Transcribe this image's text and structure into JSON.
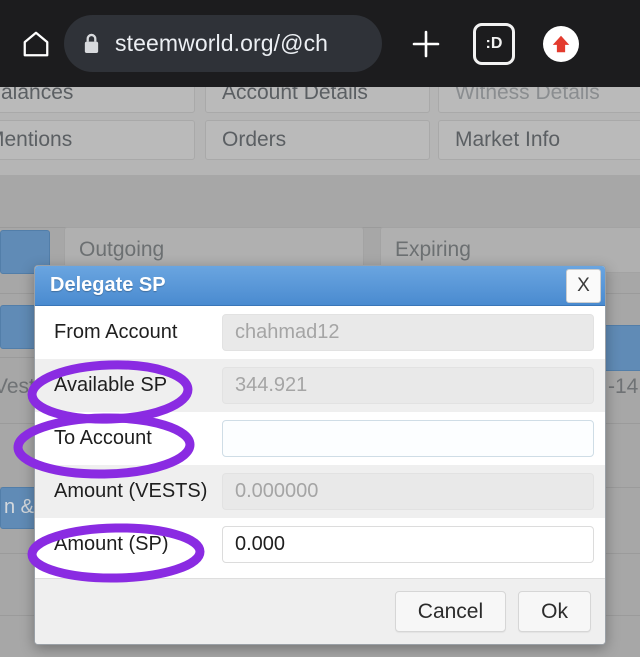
{
  "browser": {
    "url": "steemworld.org/@ch",
    "home_icon": "home-icon",
    "lock_icon": "lock-icon",
    "new_tab_label": "+",
    "tab_count_label": ":D",
    "upload_icon": "up-arrow-icon"
  },
  "page": {
    "tabs": [
      {
        "label": "Balances",
        "dim": false
      },
      {
        "label": "Account Details",
        "dim": false
      },
      {
        "label": "Witness Details",
        "dim": true
      },
      {
        "label": "Mentions",
        "dim": false
      },
      {
        "label": "Orders",
        "dim": false
      },
      {
        "label": "Market Info",
        "dim": false
      }
    ],
    "background": {
      "outgoing_label": "Outgoing",
      "expiring_label": "Expiring",
      "vests_label": "Vests",
      "n_amp_label": "n &",
      "date_fragment": "-14"
    }
  },
  "dialog": {
    "title": "Delegate SP",
    "close_label": "X",
    "fields": [
      {
        "label": "From Account",
        "value": "chahmad12",
        "state": "disabled",
        "annotated": false
      },
      {
        "label": "Available SP",
        "value": "344.921",
        "state": "disabled",
        "annotated": true
      },
      {
        "label": "To Account",
        "value": "",
        "state": "editable",
        "annotated": true
      },
      {
        "label": "Amount (VESTS)",
        "value": "0.000000",
        "state": "disabled",
        "annotated": false
      },
      {
        "label": "Amount (SP)",
        "value": "0.000",
        "state": "plain",
        "annotated": true
      }
    ],
    "cancel_label": "Cancel",
    "ok_label": "Ok"
  },
  "colors": {
    "titlebar_blue": "#4a8bd0",
    "annotation_purple": "#8a2be2",
    "browser_bar": "#1c1c1e",
    "upload_red": "#e33b2e"
  }
}
